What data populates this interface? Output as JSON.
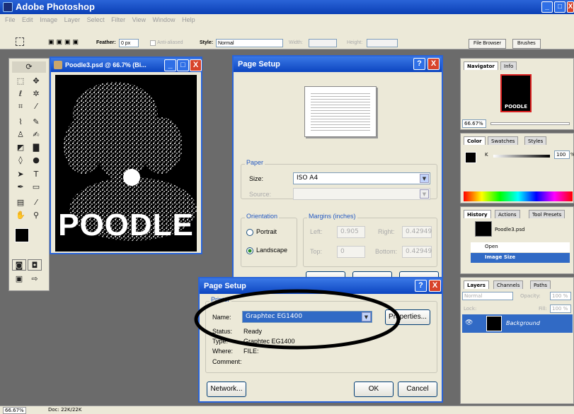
{
  "app": {
    "title": "Adobe Photoshop"
  },
  "menu": [
    "File",
    "Edit",
    "Image",
    "Layer",
    "Select",
    "Filter",
    "View",
    "Window",
    "Help"
  ],
  "options": {
    "feather_label": "Feather:",
    "feather_value": "0 px",
    "antialiased_label": "Anti-aliased",
    "style_label": "Style:",
    "style_value": "Normal",
    "width_label": "Width:",
    "height_label": "Height:",
    "file_browser": "File Browser",
    "brushes": "Brushes"
  },
  "document": {
    "title": "Poodle3.psd @ 66.7% (Bi...",
    "image_text": "POODLE"
  },
  "page_setup": {
    "title": "Page Setup",
    "paper_group": "Paper",
    "size_label": "Size:",
    "size_value": "ISO A4",
    "source_label": "Source:",
    "orientation_group": "Orientation",
    "portrait": "Portrait",
    "landscape": "Landscape",
    "margins_group": "Margins (inches)",
    "left_label": "Left:",
    "left_value": "0.905",
    "right_label": "Right:",
    "right_value": "0.42949",
    "top_label": "Top:",
    "top_value": "0",
    "bottom_label": "Bottom:",
    "bottom_value": "0.42949"
  },
  "printer_dialog": {
    "title": "Page Setup",
    "group": "Printer",
    "name_label": "Name:",
    "name_value": "Graphtec EG1400",
    "properties": "Properties...",
    "status_label": "Status:",
    "status_value": "Ready",
    "type_label": "Type:",
    "type_value": "Graphtec EG1400",
    "where_label": "Where:",
    "where_value": "FILE:",
    "comment_label": "Comment:",
    "network": "Network...",
    "ok": "OK",
    "cancel": "Cancel"
  },
  "navigator": {
    "tab_navigator": "Navigator",
    "tab_info": "Info",
    "thumb_text": "POODLE",
    "zoom": "66.67%"
  },
  "color": {
    "tab_color": "Color",
    "tab_swatches": "Swatches",
    "tab_styles": "Styles",
    "k_label": "K",
    "k_value": "100",
    "k_unit": "%"
  },
  "history": {
    "tab_history": "History",
    "tab_actions": "Actions",
    "tab_presets": "Tool Presets",
    "snapshot": "Poodle3.psd",
    "items": [
      "Open",
      "Image Size"
    ]
  },
  "layers": {
    "tab_layers": "Layers",
    "tab_channels": "Channels",
    "tab_paths": "Paths",
    "blend": "Normal",
    "opacity_label": "Opacity:",
    "opacity_value": "100 %",
    "lock_label": "Lock:",
    "fill_label": "Fill:",
    "fill_value": "100 %",
    "layer_name": "Background"
  },
  "status": {
    "zoom": "66.67%",
    "doc": "Doc: 22K/22K"
  },
  "colors": {
    "title_blue": "#0c45c0",
    "panel_bg": "#ece9d8",
    "workspace": "#6b6b6b",
    "close_red": "#d8442b"
  }
}
